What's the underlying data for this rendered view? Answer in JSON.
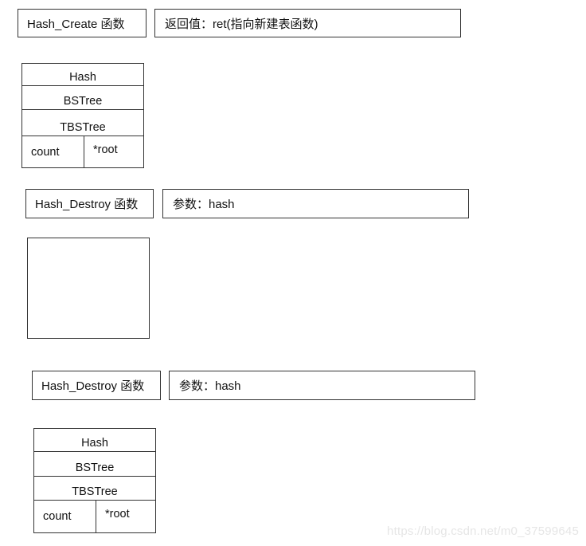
{
  "sections": [
    {
      "function_label": "Hash_Create 函数",
      "info_label": "返回值：ret(指向新建表函数)",
      "struct": {
        "rows": [
          "Hash",
          "BSTree",
          "TBSTree"
        ],
        "fields": [
          "count",
          "*root"
        ]
      }
    },
    {
      "function_label": "Hash_Destroy 函数",
      "info_label": "参数：hash",
      "struct": null
    },
    {
      "function_label": "Hash_Destroy 函数",
      "info_label": "参数：hash",
      "struct": {
        "rows": [
          "Hash",
          "BSTree",
          "TBSTree"
        ],
        "fields": [
          "count",
          "*root"
        ]
      }
    }
  ],
  "watermark": "https://blog.csdn.net/m0_37599645"
}
